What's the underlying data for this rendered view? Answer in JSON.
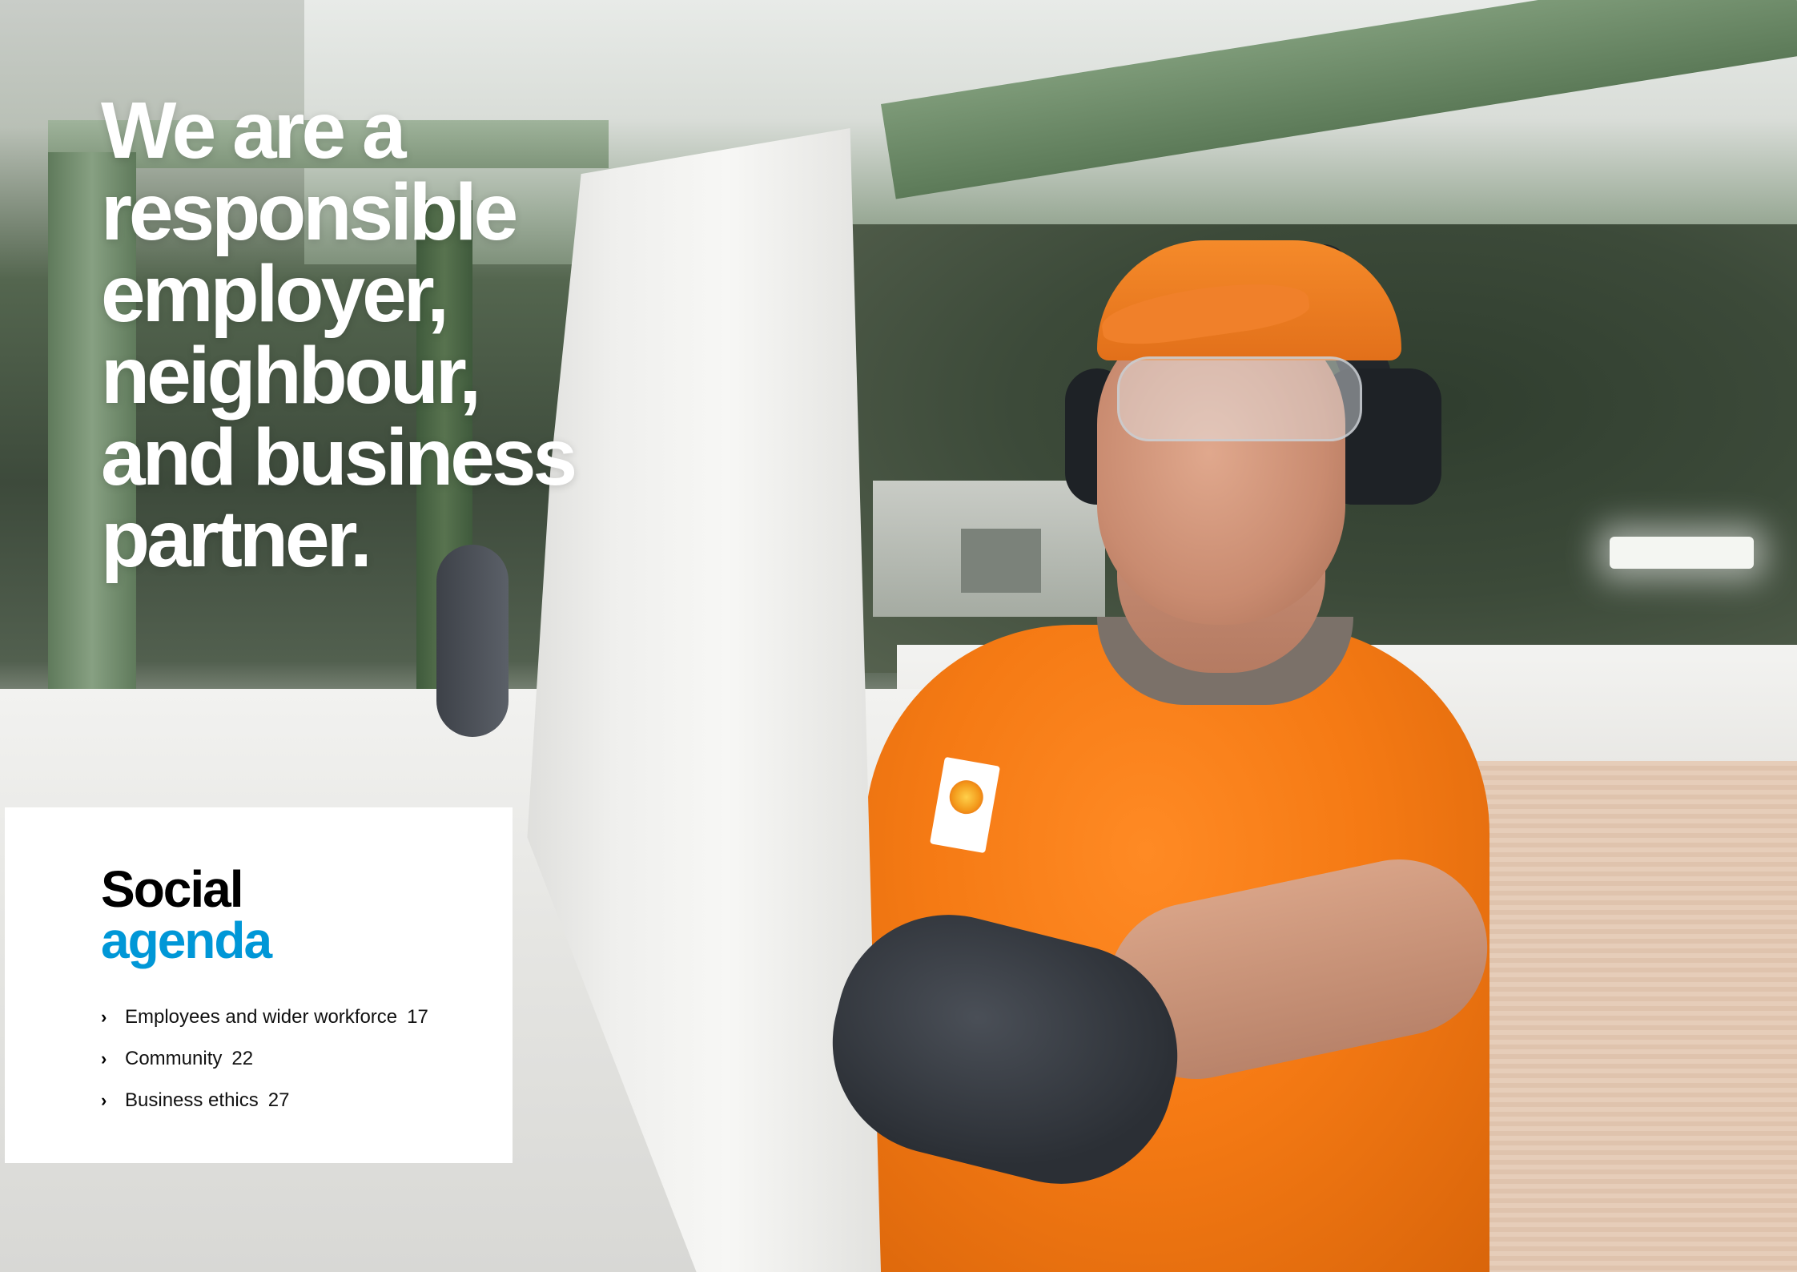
{
  "headline": {
    "lines": [
      "We are a",
      "responsible",
      "employer,",
      "neighbour,",
      "and business",
      "partner."
    ]
  },
  "panel": {
    "title_line1": "Social",
    "title_line2": "agenda",
    "accent_color": "#0097d7",
    "items": [
      {
        "label": "Employees and wider workforce",
        "page": "17"
      },
      {
        "label": "Community",
        "page": "22"
      },
      {
        "label": "Business ethics",
        "page": "27"
      }
    ],
    "bullet_icon": "chevron-right-icon"
  },
  "photo": {
    "subject_icon": "factory-worker-photo"
  }
}
